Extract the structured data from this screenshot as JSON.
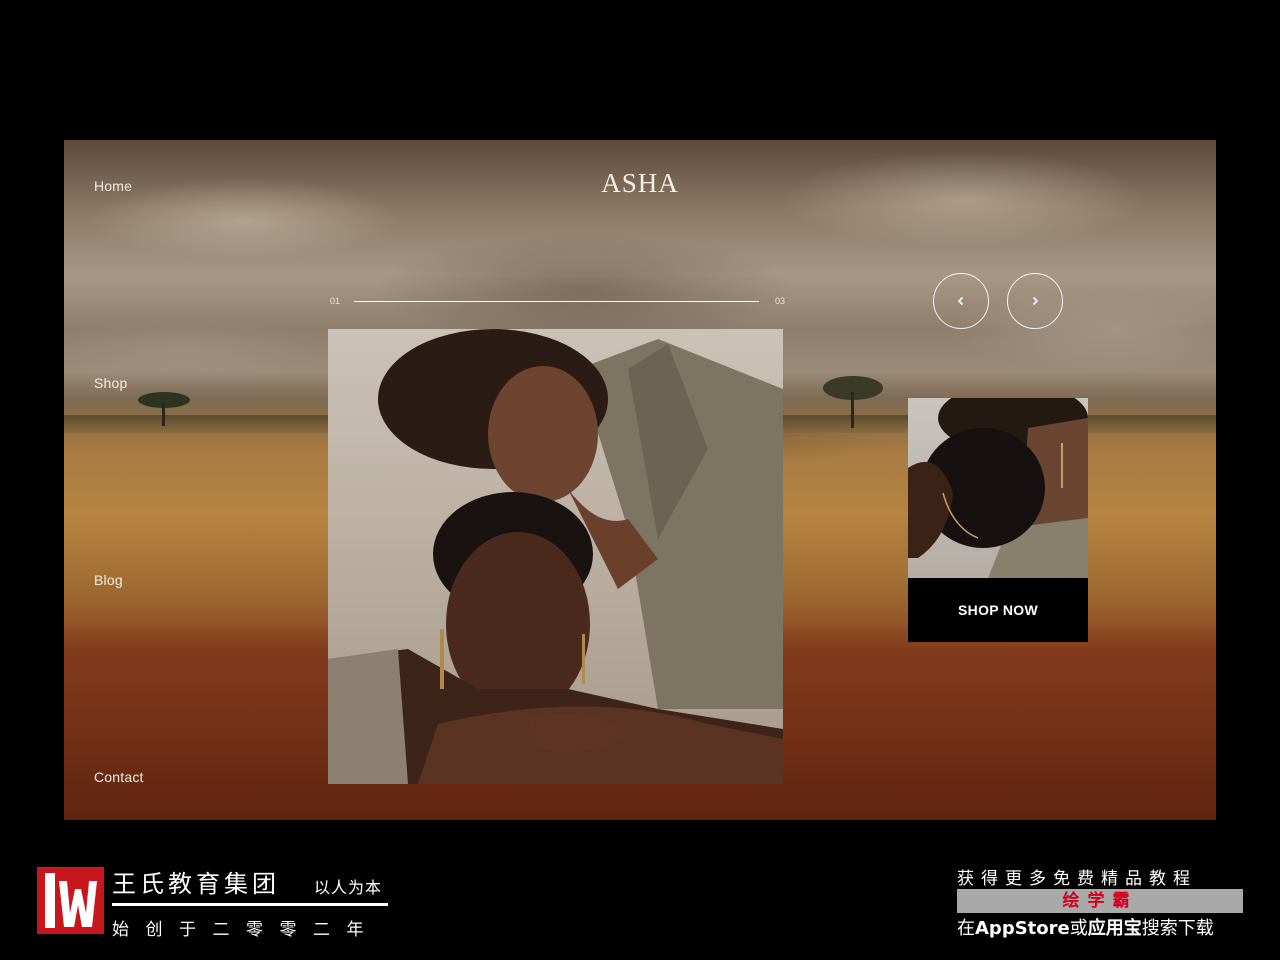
{
  "site": {
    "logo": "ASHA",
    "nav": [
      {
        "label": "Home"
      },
      {
        "label": "Shop"
      },
      {
        "label": "Blog"
      },
      {
        "label": "Contact"
      }
    ],
    "slider": {
      "current": "01",
      "total": "03",
      "progress_fraction": 1.0,
      "prev_icon": "chevron-left-icon",
      "next_icon": "chevron-right-icon"
    },
    "cta_label": "SHOP NOW"
  },
  "footer": {
    "brand_name": "王氏教育集团",
    "motto": "以人为本",
    "since": "始创于二零零二年",
    "promo_line1": "获得更多免费精品教程",
    "promo_highlight": "绘学霸",
    "promo_line3_a": "在",
    "promo_line3_b": "AppStore",
    "promo_line3_c": "或",
    "promo_line3_d": "应用宝",
    "promo_line3_e": "搜索下载"
  },
  "colors": {
    "accent_red": "#d2001e",
    "cta_background": "#000000"
  }
}
